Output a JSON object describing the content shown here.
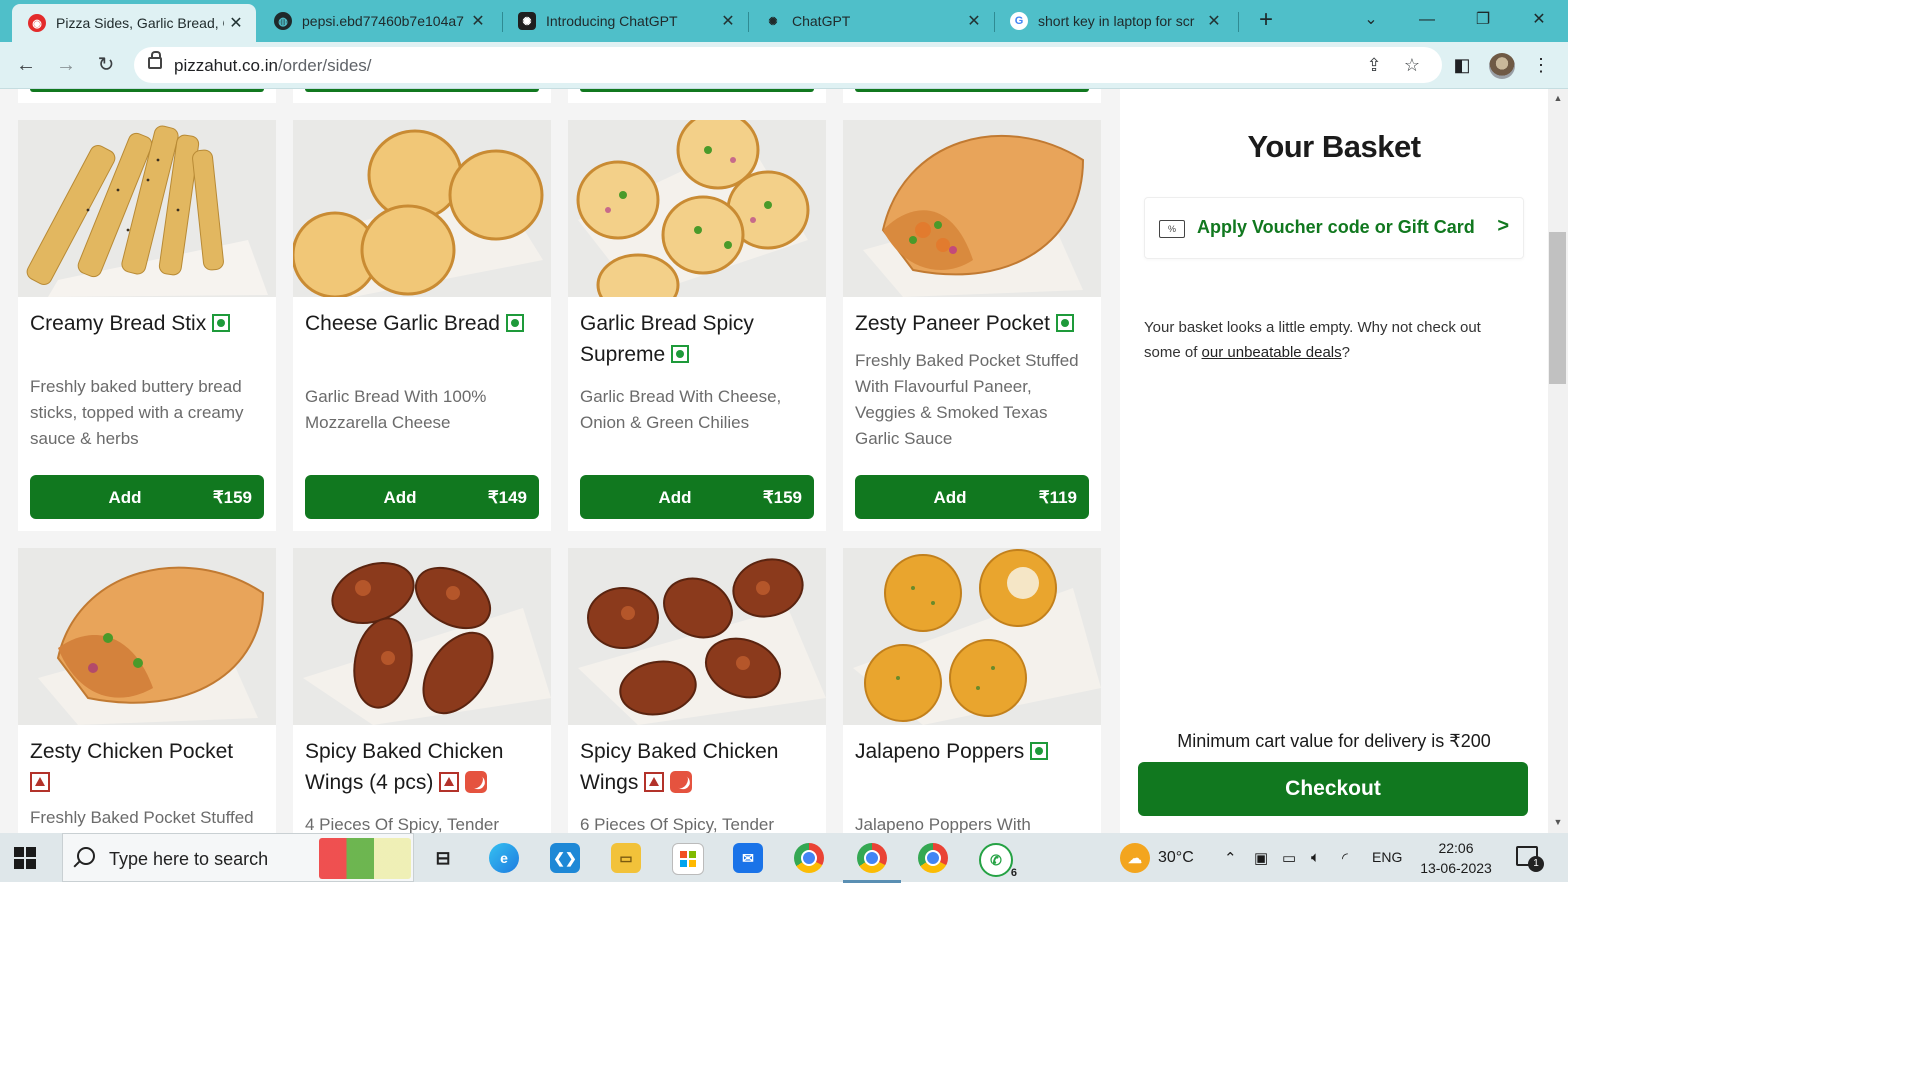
{
  "browser": {
    "tabs": [
      {
        "title": "Pizza Sides, Garlic Bread, C",
        "active": true,
        "favicon": "pizzahut-icon"
      },
      {
        "title": "pepsi.ebd77460b7e104a7",
        "active": false,
        "favicon": "globe-icon"
      },
      {
        "title": "Introducing ChatGPT",
        "active": false,
        "favicon": "openai-icon"
      },
      {
        "title": "ChatGPT",
        "active": false,
        "favicon": "openai-icon"
      },
      {
        "title": "short key in laptop for scr",
        "active": false,
        "favicon": "google-icon"
      }
    ],
    "url_domain": "pizzahut.co.in",
    "url_path": "/order/sides/"
  },
  "products": [
    {
      "name": "Creamy Bread Stix",
      "diet": "veg",
      "spicy": false,
      "description": "Freshly baked buttery bread sticks, topped with a creamy sauce & herbs",
      "add_label": "Add",
      "price": "₹159"
    },
    {
      "name": "Cheese Garlic Bread",
      "diet": "veg",
      "spicy": false,
      "description": "Garlic Bread With 100% Mozzarella Cheese",
      "add_label": "Add",
      "price": "₹149"
    },
    {
      "name": "Garlic Bread Spicy Supreme",
      "diet": "veg",
      "spicy": false,
      "description": "Garlic Bread With Cheese, Onion & Green Chilies",
      "add_label": "Add",
      "price": "₹159"
    },
    {
      "name": "Zesty Paneer Pocket",
      "diet": "veg",
      "spicy": false,
      "description": "Freshly Baked Pocket Stuffed With Flavourful Paneer, Veggies & Smoked Texas Garlic Sauce",
      "add_label": "Add",
      "price": "₹119"
    },
    {
      "name": "Zesty Chicken Pocket",
      "diet": "nonveg",
      "spicy": false,
      "description": "Freshly Baked Pocket Stuffed"
    },
    {
      "name": "Spicy Baked Chicken Wings (4 pcs)",
      "diet": "nonveg",
      "spicy": true,
      "description": "4 Pieces Of Spicy, Tender"
    },
    {
      "name": "Spicy Baked Chicken Wings",
      "diet": "nonveg",
      "spicy": true,
      "description": "6 Pieces Of Spicy, Tender"
    },
    {
      "name": "Jalapeno Poppers",
      "diet": "veg",
      "spicy": false,
      "description": "Jalapeno Poppers With"
    }
  ],
  "basket": {
    "title": "Your Basket",
    "voucher_label": "Apply Voucher code or Gift Card",
    "voucher_arrow": ">",
    "empty_text": "Your basket looks a little empty. Why not check out some of ",
    "deals_link": "our unbeatable deals",
    "empty_suffix": "?",
    "min_cart_text": "Minimum cart value for delivery is ₹200",
    "checkout_label": "Checkout"
  },
  "taskbar": {
    "search_placeholder": "Type here to search",
    "weather": "30°C",
    "language": "ENG",
    "time": "22:06",
    "date": "13-06-2023",
    "notification_count": "1",
    "whatsapp_badge": "6"
  },
  "colors": {
    "brand_green": "#11781f",
    "veg_green": "#1e9a3a",
    "nonveg_red": "#b3322a",
    "tabstrip": "#4fbfc9"
  }
}
